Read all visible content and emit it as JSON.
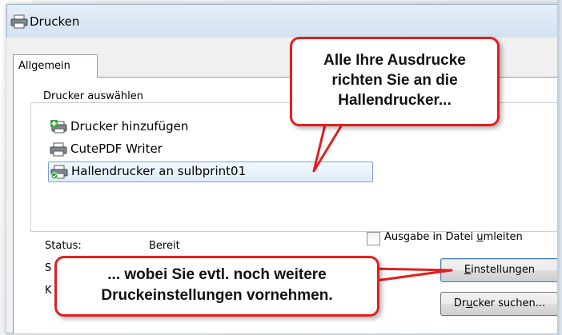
{
  "window": {
    "title": "Drucken",
    "icon": "printer-icon"
  },
  "tabs": [
    {
      "label": "Allgemein",
      "active": true
    }
  ],
  "printer_select": {
    "group_label": "Drucker auswählen",
    "items": [
      {
        "label": "Drucker hinzufügen",
        "icon": "add-printer-icon",
        "selected": false
      },
      {
        "label": "CutePDF Writer",
        "icon": "printer-icon",
        "selected": false
      },
      {
        "label": "Hallendrucker an sulbprint01",
        "icon": "network-printer-icon",
        "selected": true
      }
    ]
  },
  "status": {
    "label": "Status:",
    "value": "Bereit",
    "partial_label_1": "S",
    "partial_label_2": "K"
  },
  "options": {
    "print_to_file_pre": "Ausgabe in Datei ",
    "print_to_file_accel": "u",
    "print_to_file_post": "mleiten",
    "print_to_file_checked": false
  },
  "buttons": {
    "settings_accel": "E",
    "settings_rest": "instellungen",
    "find_pre": "Dr",
    "find_accel": "u",
    "find_post": "cker suchen..."
  },
  "annotations": {
    "top_lines": [
      "Alle Ihre Ausdrucke",
      "richten Sie an die",
      "Hallendrucker..."
    ],
    "bottom_lines": [
      "... wobei Sie evtl. noch weitere",
      "Druckeinstellungen vornehmen."
    ],
    "border_color": "#e02020"
  }
}
